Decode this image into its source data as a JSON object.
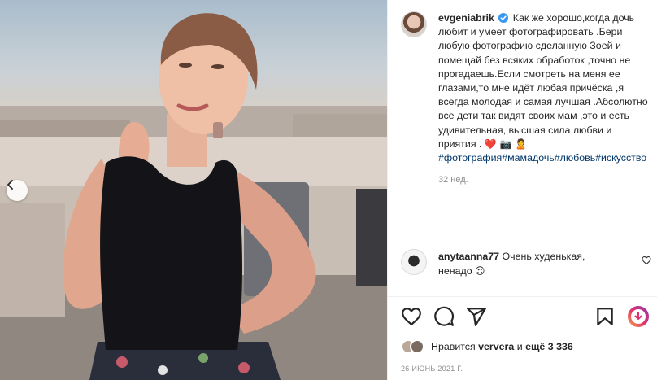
{
  "post": {
    "username": "evgeniabrik",
    "caption": "Как же хорошо,когда дочь любит и умеет фотографировать .Бери любую фотографию сделанную Зоей и помещай без всяких обработок ,точно не прогадаешь.Если смотреть на меня ее глазами,то мне идёт любая причёска ,я всегда молодая и самая лучшая .Абсолютно все дети так видят своих мам ,это и есть удивительная, высшая сила любви и приятия .",
    "caption_emojis": "❤️ 📷 🙎",
    "hashtags": "#фотография#мамадочь#любовь#искусство",
    "time_ago": "32 нед."
  },
  "comment": {
    "username": "anytaanna77",
    "text": "Очень худенькая, ненадо",
    "emoji": "😍"
  },
  "likes": {
    "prefix": "Нравится",
    "user": "ververa",
    "middle": "и",
    "others": "ещё 3 336"
  },
  "date": "26 ИЮНЬ 2021 Г.",
  "icons": {
    "verified": "verified-badge-icon",
    "like": "heart-icon",
    "comment": "comment-bubble-icon",
    "share": "paper-plane-icon",
    "save": "bookmark-icon",
    "download": "download-badge-icon",
    "carousel_prev": "chevron-left-icon"
  },
  "colors": {
    "link": "#00376b",
    "verified": "#3897f0",
    "muted": "#8e8e8e"
  }
}
